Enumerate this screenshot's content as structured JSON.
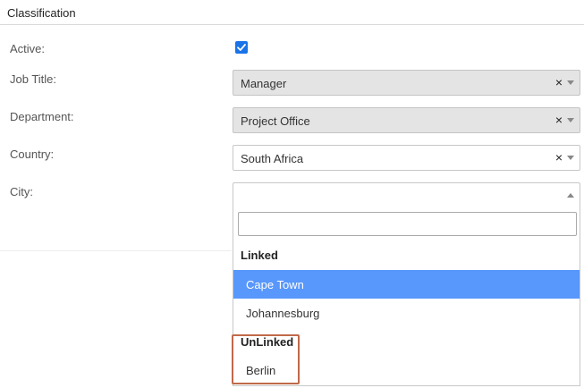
{
  "section": {
    "title": "Classification"
  },
  "fields": {
    "active": {
      "label": "Active:",
      "checked": true
    },
    "job_title": {
      "label": "Job Title:",
      "value": "Manager",
      "clear": "×"
    },
    "department": {
      "label": "Department:",
      "value": "Project Office",
      "clear": "×"
    },
    "country": {
      "label": "Country:",
      "value": "South Africa",
      "clear": "×"
    },
    "city": {
      "label": "City:",
      "value": ""
    }
  },
  "dropdown": {
    "search_value": "",
    "groups": [
      {
        "label": "Linked",
        "options": [
          {
            "label": "Cape Town",
            "highlighted": true
          },
          {
            "label": "Johannesburg",
            "highlighted": false
          }
        ]
      },
      {
        "label": "UnLinked",
        "options": [
          {
            "label": "Berlin",
            "highlighted": false
          }
        ]
      }
    ]
  },
  "colors": {
    "highlight": "#5897fb",
    "checkbox": "#1a73e8",
    "annotation": "#c0694a",
    "disabled_bg": "#e4e4e4"
  },
  "icons": {
    "clear": "close-icon",
    "arrow": "chevron-down-icon",
    "checkmark": "checkmark-icon"
  }
}
